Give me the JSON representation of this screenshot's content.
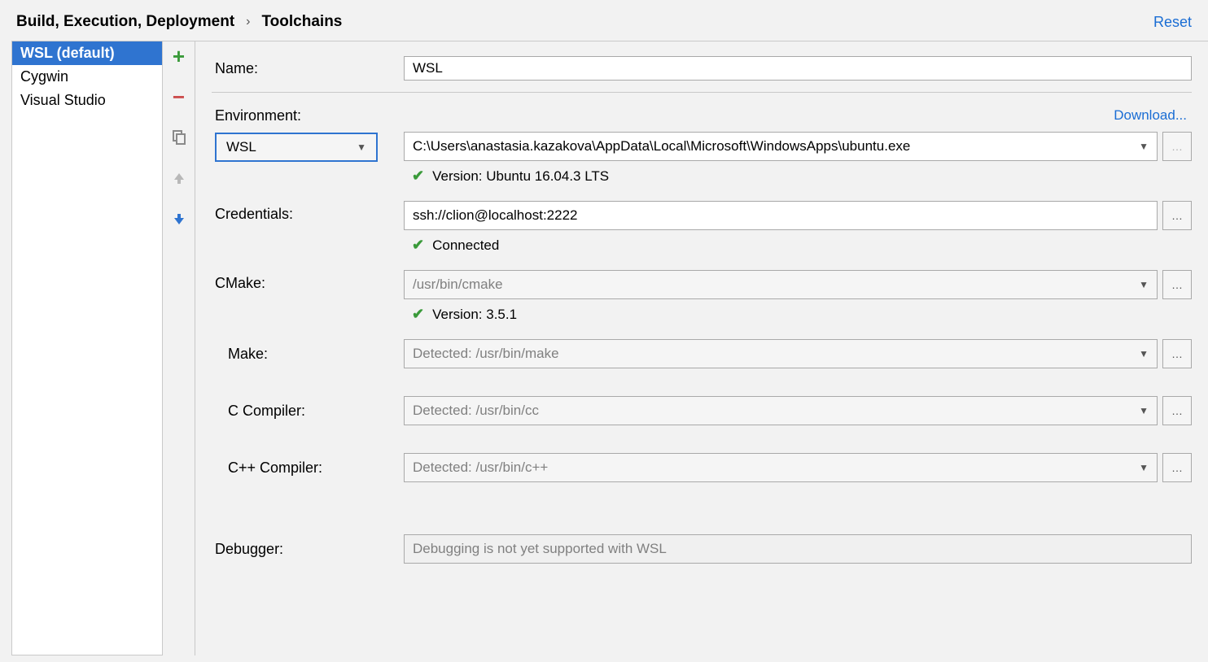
{
  "breadcrumb": {
    "parent": "Build, Execution, Deployment",
    "current": "Toolchains"
  },
  "reset_label": "Reset",
  "toolchains": [
    {
      "label": "WSL (default)",
      "selected": true
    },
    {
      "label": "Cygwin",
      "selected": false
    },
    {
      "label": "Visual Studio",
      "selected": false
    }
  ],
  "labels": {
    "name": "Name:",
    "environment": "Environment:",
    "download": "Download...",
    "credentials": "Credentials:",
    "cmake": "CMake:",
    "make": "Make:",
    "c_compiler": "C Compiler:",
    "cpp_compiler": "C++ Compiler:",
    "debugger": "Debugger:"
  },
  "fields": {
    "name_value": "WSL",
    "env_type": "WSL",
    "env_path": "C:\\Users\\anastasia.kazakova\\AppData\\Local\\Microsoft\\WindowsApps\\ubuntu.exe",
    "env_status": "Version: Ubuntu 16.04.3 LTS",
    "credentials_value": "ssh://clion@localhost:2222",
    "credentials_status": "Connected",
    "cmake_value": "/usr/bin/cmake",
    "cmake_status": "Version: 3.5.1",
    "make_value": "Detected: /usr/bin/make",
    "c_compiler_value": "Detected: /usr/bin/cc",
    "cpp_compiler_value": "Detected: /usr/bin/c++",
    "debugger_value": "Debugging is not yet supported with WSL"
  }
}
